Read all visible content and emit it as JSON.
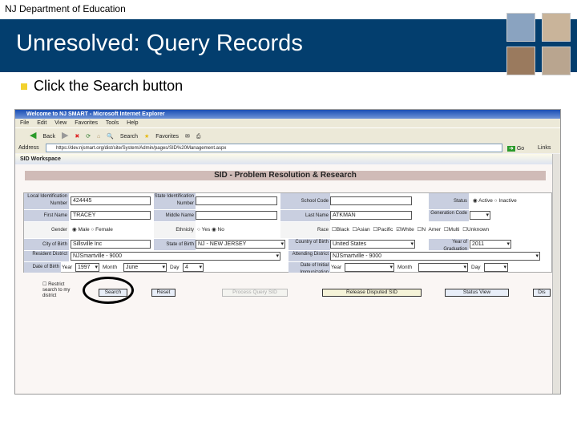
{
  "slide": {
    "org": "NJ Department of Education",
    "title": "Unresolved:  Query Records",
    "bullet": "Click the Search button",
    "accent_banner": "#033e6e",
    "bullet_color": "#f2d12e"
  },
  "browser": {
    "title": "Welcome to NJ SMART - Microsoft Internet Explorer",
    "menu": [
      "File",
      "Edit",
      "View",
      "Favorites",
      "Tools",
      "Help"
    ],
    "toolbar": [
      "Back",
      "Search",
      "Favorites"
    ],
    "address_label": "Address",
    "address": "https://dev.njsmart.org/dist/site/System/Admin/pages/SID%20Management.aspx",
    "go": "Go",
    "links": "Links"
  },
  "workspace": {
    "header": "SID Workspace",
    "heading": "SID - Problem Resolution & Research",
    "fields": {
      "local_id_label": "Local Identification Number",
      "local_id": "424445",
      "state_id_label": "State Identification Number",
      "state_id": "",
      "school_label": "School Code",
      "school": "",
      "status_label": "Status",
      "status_active": "Active",
      "status_inactive": "Inactive",
      "first_name_label": "First Name",
      "first_name": "TRACEY",
      "middle_name_label": "Middle Name",
      "middle_name": "",
      "last_name_label": "Last Name",
      "last_name": "ATKMAN",
      "generation_label": "Generation Code",
      "generation": "",
      "gender_label": "Gender",
      "male": "Male",
      "female": "Female",
      "ethnicity_label": "Ethnicity",
      "yes": "Yes",
      "no": "No",
      "race_label": "Race",
      "races": [
        "Black",
        "Asian",
        "Pacific",
        "White",
        "N Amer",
        "Multi",
        "Unknown"
      ],
      "city_label": "City of Birth",
      "city": "Sillsville Inc",
      "state_birth_label": "State of Birth",
      "state_birth": "NJ - NEW JERSEY",
      "country_label": "Country of Birth",
      "country": "United States",
      "year_grad_label": "Year of Graduation",
      "year_grad": "2011",
      "resident_label": "Resident District",
      "resident": "NJSmartville - 9000",
      "attending_label": "Attending District",
      "attending": "NJSmartville - 9000",
      "dob_label": "Date of Birth",
      "year_label": "Year",
      "dob_year": "1997",
      "month_label": "Month",
      "dob_month": "June",
      "day_label": "Day",
      "dob_day": "4",
      "immun_label": "Date of Initial Immunization"
    },
    "checkbox": "Restrict search to my district",
    "buttons": {
      "search": "Search",
      "reset": "Reset",
      "process": "Process Query SID",
      "release": "Release Disputed SID",
      "status": "Status View",
      "more": "Dis"
    }
  }
}
